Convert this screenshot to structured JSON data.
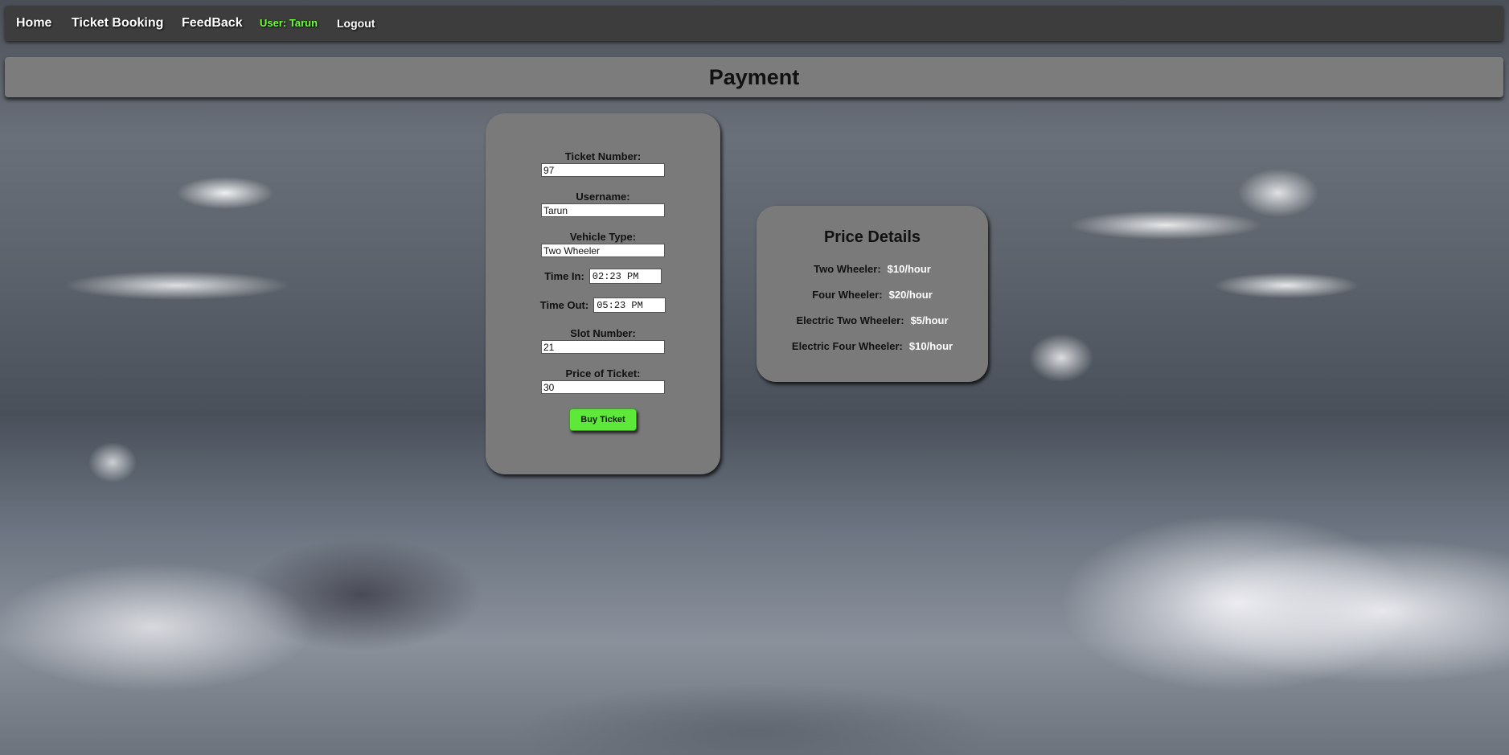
{
  "nav": {
    "home": "Home",
    "ticket_booking": "Ticket Booking",
    "feedback": "FeedBack",
    "user_label": "User:",
    "user_name": "Tarun",
    "logout": "Logout"
  },
  "header": {
    "title": "Payment"
  },
  "form": {
    "ticket_number": {
      "label": "Ticket Number:",
      "value": "97"
    },
    "username": {
      "label": "Username:",
      "value": "Tarun"
    },
    "vehicle_type": {
      "label": "Vehicle Type:",
      "value": "Two Wheeler"
    },
    "time_in": {
      "label": "Time In:",
      "value": "02:23 PM"
    },
    "time_out": {
      "label": "Time Out:",
      "value": "05:23 PM"
    },
    "slot_number": {
      "label": "Slot Number:",
      "value": "21"
    },
    "price": {
      "label": "Price of Ticket:",
      "value": "30"
    },
    "buy_button": "Buy Ticket"
  },
  "price_details": {
    "title": "Price Details",
    "rows": [
      {
        "type": "Two Wheeler:",
        "rate": "$10/hour"
      },
      {
        "type": "Four Wheeler:",
        "rate": "$20/hour"
      },
      {
        "type": "Electric Two Wheeler:",
        "rate": "$5/hour"
      },
      {
        "type": "Electric Four Wheeler:",
        "rate": "$10/hour"
      }
    ]
  },
  "colors": {
    "accent_green": "#5ee83a",
    "user_green": "#6cff3a",
    "card_gray": "#7a7a7a",
    "nav_dark": "#3d3d3d"
  }
}
